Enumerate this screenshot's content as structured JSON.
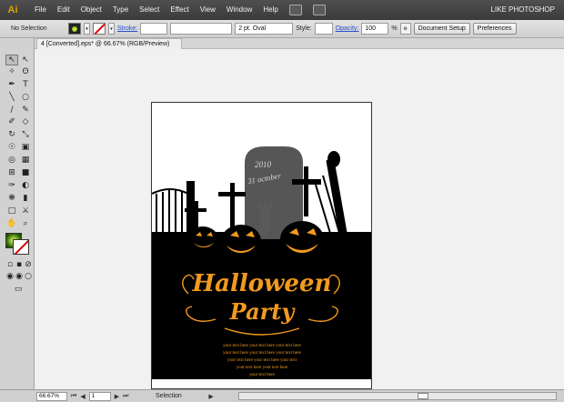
{
  "app": {
    "logo": "Ai",
    "menu": [
      "File",
      "Edit",
      "Object",
      "Type",
      "Select",
      "Effect",
      "View",
      "Window",
      "Help"
    ],
    "workspace": "LIKE PHOTOSHOP"
  },
  "control": {
    "selection": "No Selection",
    "stroke_label": "Stroke:",
    "brush": "2 pt. Oval",
    "style_label": "Style:",
    "opacity_label": "Opacity:",
    "opacity_value": "100",
    "percent": "%",
    "document_setup": "Document Setup",
    "preferences": "Preferences"
  },
  "document": {
    "tab_title": "4 [Converted].eps* @ 66.67% (RGB/Preview)"
  },
  "artwork": {
    "date_line1": "2010",
    "date_line2": "31 october",
    "title1": "Halloween",
    "title2": "Party",
    "body_lines": [
      "your text here your text here your text here",
      "your text here your text here your text here",
      "your text here your text here your text",
      "your text here your text here",
      "your text here"
    ]
  },
  "status": {
    "zoom": "66.67%",
    "page": "1",
    "mode": "Selection"
  },
  "colors": {
    "orange": "#f29a1e",
    "gold": "#ffcc33",
    "gravestone": "#5a5a5a"
  }
}
